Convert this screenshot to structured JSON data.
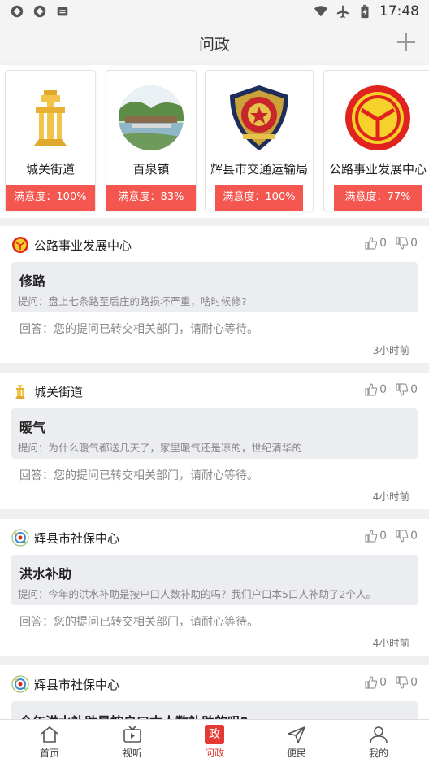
{
  "status_bar": {
    "time": "17:48"
  },
  "header": {
    "title": "问政"
  },
  "departments": [
    {
      "name": "城关街道",
      "satisfaction": "满意度：100%"
    },
    {
      "name": "百泉镇",
      "satisfaction": "满意度：83%"
    },
    {
      "name": "辉县市交通运输局",
      "satisfaction": "满意度：100%"
    },
    {
      "name": "公路事业发展中心",
      "satisfaction": "满意度：77%"
    }
  ],
  "posts": [
    {
      "dept": "公路事业发展中心",
      "likes": "0",
      "dislikes": "0",
      "title": "修路",
      "question": "提问：盘上七条路至后庄的路损坏严重，啥时候修?",
      "answer": "回答：您的提问已转交相关部门，请耐心等待。",
      "time": "3小时前"
    },
    {
      "dept": "城关街道",
      "likes": "0",
      "dislikes": "0",
      "title": "暖气",
      "question": "提问：为什么暖气都送几天了，家里暖气还是凉的，世纪清华的",
      "answer": "回答：您的提问已转交相关部门，请耐心等待。",
      "time": "4小时前"
    },
    {
      "dept": "辉县市社保中心",
      "likes": "0",
      "dislikes": "0",
      "title": "洪水补助",
      "question": "提问：今年的洪水补助是按户口人数补助的吗？我们户口本5口人补助了2个人。",
      "answer": "回答：您的提问已转交相关部门，请耐心等待。",
      "time": "4小时前"
    },
    {
      "dept": "辉县市社保中心",
      "likes": "0",
      "dislikes": "0",
      "title": "今年洪水补助是按户口本人数补助的吗?"
    }
  ],
  "bottom_nav": {
    "home": "首页",
    "video": "视听",
    "zheng_badge": "政",
    "wenzheng": "问政",
    "service": "便民",
    "mine": "我的"
  },
  "colors": {
    "accent": "#e53a33",
    "satisfaction_bg": "#f3574f",
    "question_bg": "#ecedf0"
  }
}
